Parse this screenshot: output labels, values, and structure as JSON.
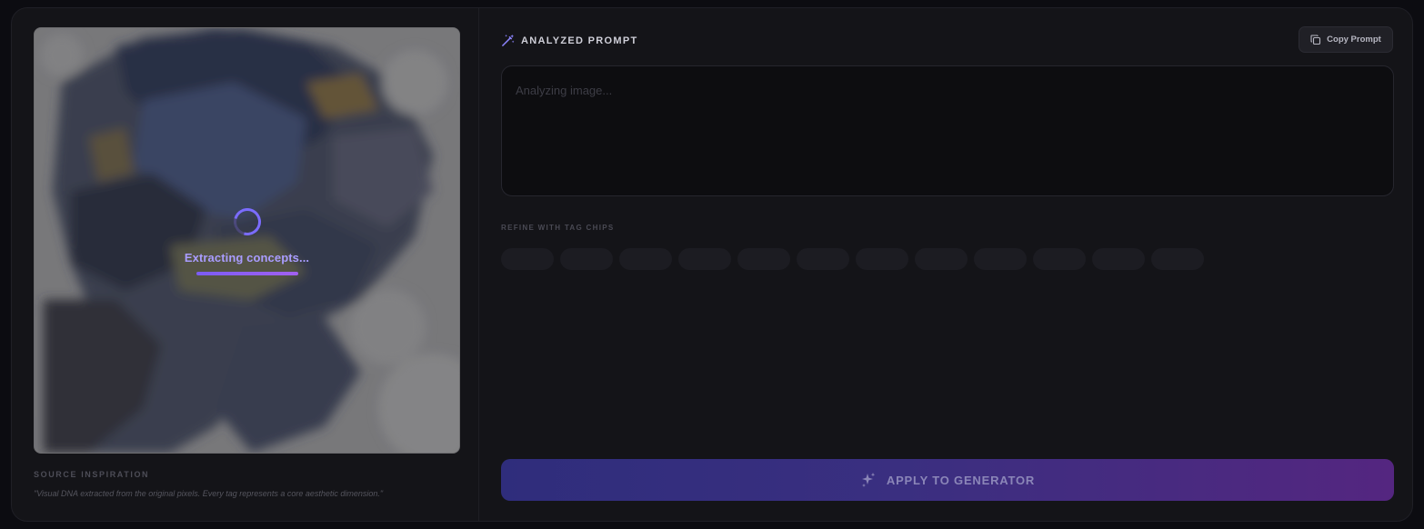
{
  "source": {
    "loading_text": "Extracting concepts...",
    "section_label": "SOURCE INSPIRATION",
    "quote": "\"Visual DNA extracted from the original pixels. Every tag represents a core aesthetic dimension.\""
  },
  "analysis": {
    "title": "ANALYZED PROMPT",
    "copy_label": "Copy Prompt",
    "prompt_placeholder": "Analyzing image...",
    "refine_label": "REFINE WITH TAG CHIPS",
    "chip_count": 12,
    "apply_label": "APPLY TO GENERATOR"
  },
  "icons": {
    "header": "magic-wand-icon",
    "copy": "copy-icon",
    "apply": "sparkles-icon"
  },
  "colors": {
    "accent": "#7b6cff",
    "loader_text": "#a99cff",
    "apply_gradient_start": "#2f2d7c",
    "apply_gradient_end": "#542680"
  }
}
